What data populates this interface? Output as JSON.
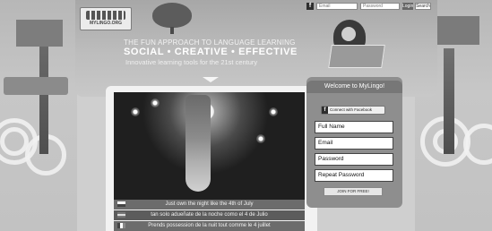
{
  "top_bar": {
    "fb_icon": "f",
    "email_placeholder": "Email",
    "password_placeholder": "Password",
    "login_label": "Login",
    "search_label": "Search"
  },
  "brand": {
    "logo_text": "MYLINGO.ORG"
  },
  "hero": {
    "tagline_line1": "THE FUN APPROACH TO LANGUAGE LEARNING",
    "tagline_line2": "SOCIAL • CREATIVE • EFFECTIVE",
    "tagline_line3": "Innovative learning tools for the 21st century"
  },
  "video": {
    "subtitles": [
      {
        "text": "Just own the night like the 4th of July"
      },
      {
        "text": "tan solo adueñate de la noche como el 4 de Julio"
      },
      {
        "text": "Prends possession de la nuit tout comme le 4 juillet"
      }
    ]
  },
  "signup": {
    "title": "Welcome to MyLingo!",
    "fb_connect_label": "Connect with Facebook",
    "fields": [
      {
        "label": "Full Name"
      },
      {
        "label": "Email"
      },
      {
        "label": "Password"
      },
      {
        "label": "Repeat Password"
      }
    ],
    "join_label": "JOIN FOR FREE!"
  }
}
